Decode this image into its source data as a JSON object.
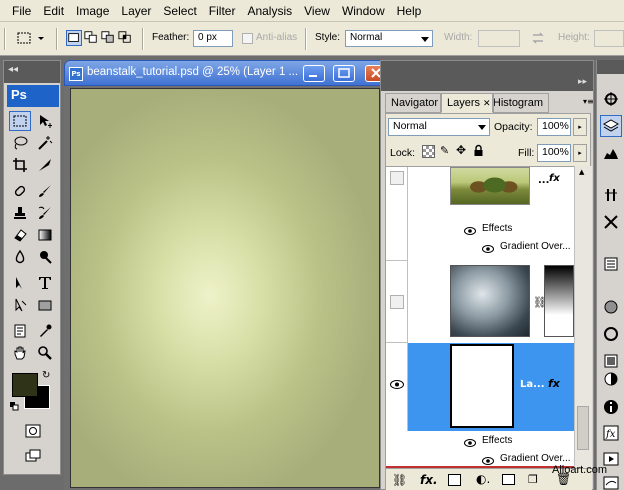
{
  "menu": [
    "File",
    "Edit",
    "Image",
    "Layer",
    "Select",
    "Filter",
    "Analysis",
    "View",
    "Window",
    "Help"
  ],
  "options": {
    "feather_label": "Feather:",
    "feather_value": "0 px",
    "antialias_label": "Anti-alias",
    "style_label": "Style:",
    "style_value": "Normal",
    "width_label": "Width:",
    "height_label": "Height:"
  },
  "toolbox": {
    "logo": "Ps"
  },
  "document": {
    "title": "beanstalk_tutorial.psd @ 25% (Layer 1 ..."
  },
  "panel": {
    "tabs": [
      "Navigator",
      "Layers",
      "Histogram"
    ],
    "blend_mode": "Normal",
    "opacity_label": "Opacity:",
    "opacity_value": "100%",
    "lock_label": "Lock:",
    "fill_label": "Fill:",
    "fill_value": "100%",
    "layers": [
      {
        "name": "...",
        "effects_label": "Effects",
        "effect": "Gradient Over..."
      },
      {
        "name": "",
        "effects_label": "",
        "effect": ""
      },
      {
        "name": "La...",
        "effects_label": "Effects",
        "effect": "Gradient Over..."
      }
    ]
  },
  "watermark": "Alloart.com",
  "colors": {
    "foreground": "#2f3318",
    "background": "#000000",
    "selection": "#3d95f0"
  }
}
